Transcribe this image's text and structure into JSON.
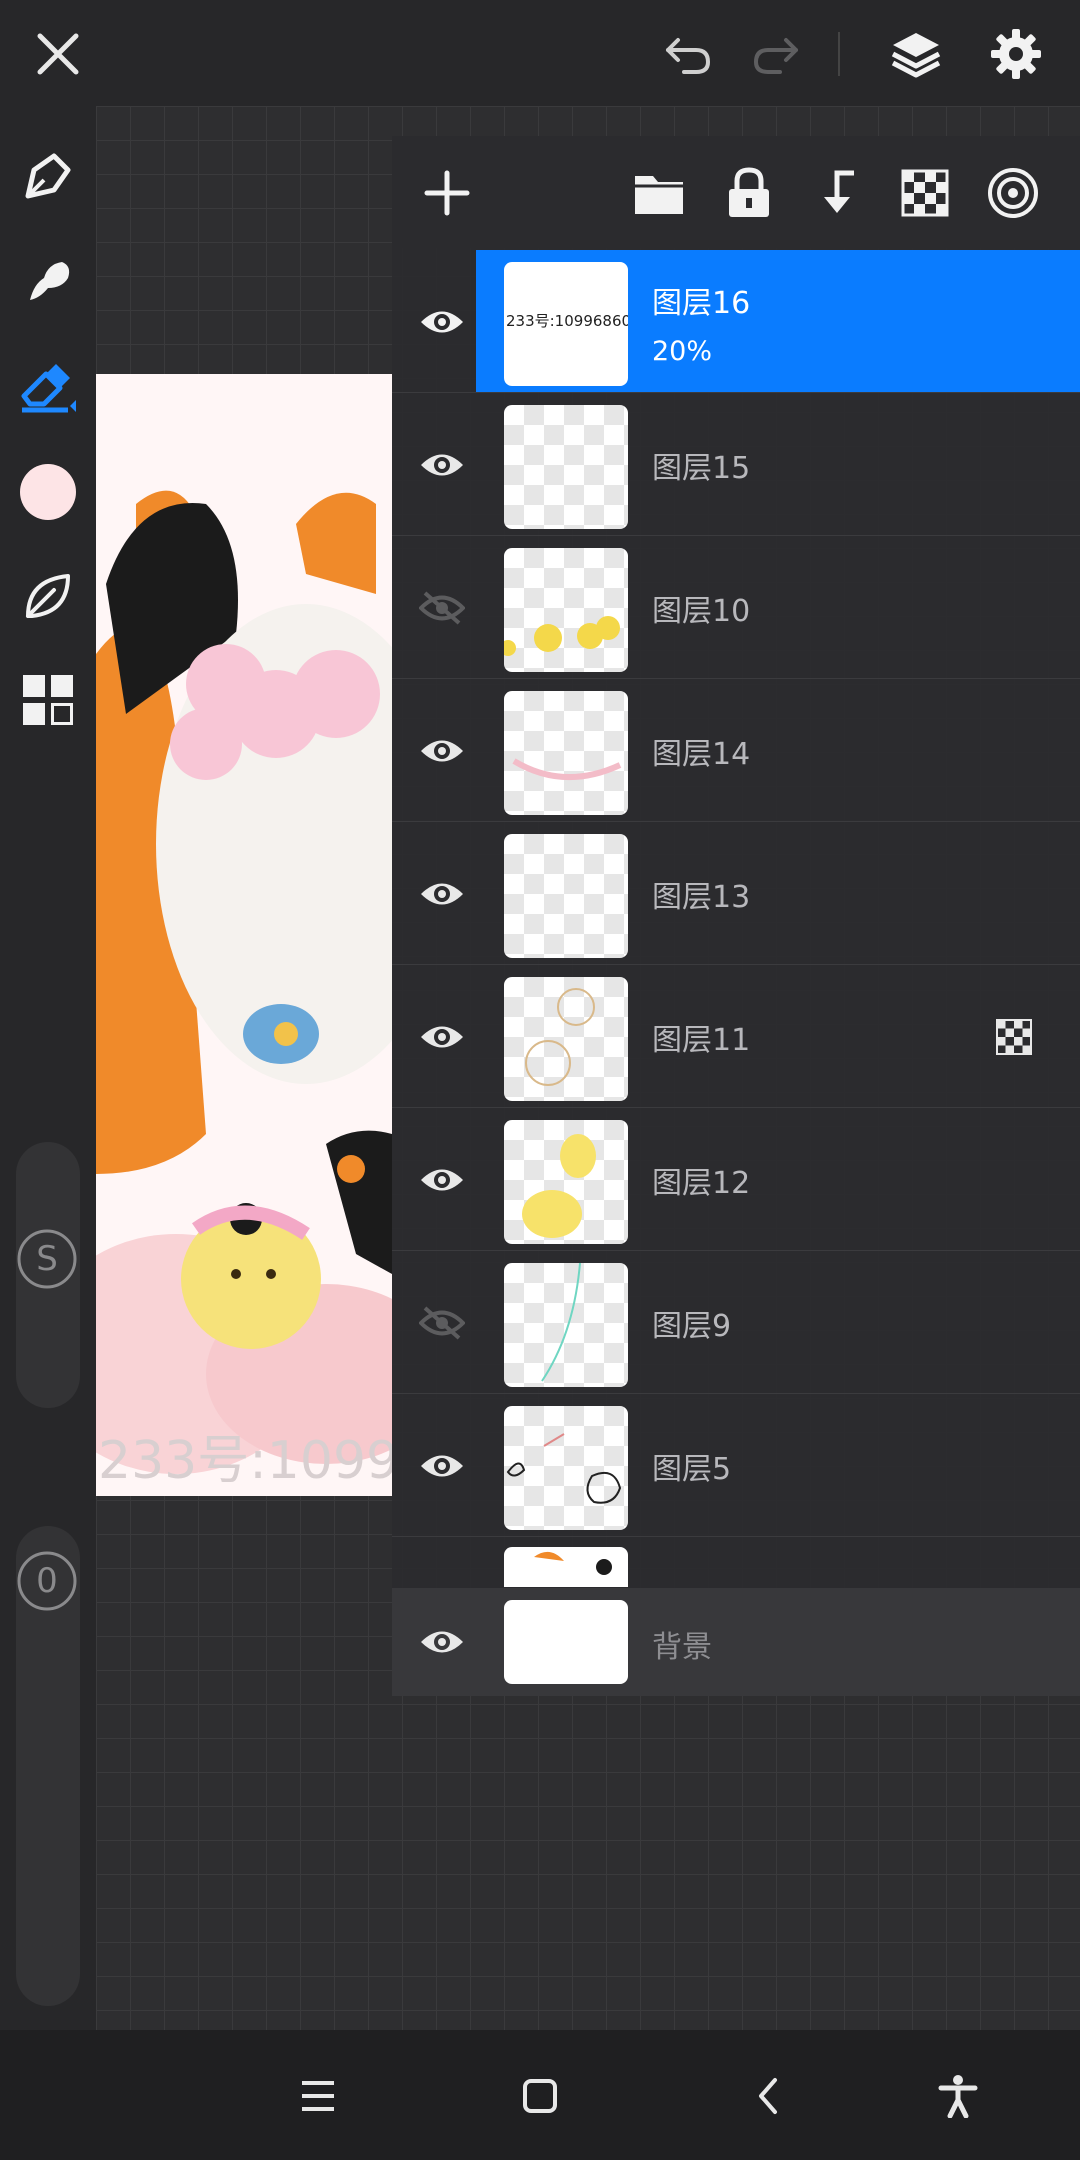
{
  "colors": {
    "accent": "#0a7cff",
    "brush_color": "#fde4e6"
  },
  "topbar": {
    "icons": [
      "close-icon",
      "undo-icon",
      "redo-icon",
      "layers-icon",
      "settings-icon"
    ]
  },
  "toolbar": {
    "tools": [
      "pen-icon",
      "smudge-icon",
      "eraser-icon",
      "color-swatch",
      "leaf-icon",
      "grid-icon"
    ],
    "size_label": "S",
    "opacity_label": "0"
  },
  "artwork": {
    "watermark": "233号:1099"
  },
  "layers_panel": {
    "tools": [
      "add-icon",
      "folder-icon",
      "lock-icon",
      "merge-down-icon",
      "alpha-lock-icon",
      "target-icon"
    ],
    "layers": [
      {
        "name": "图层16",
        "opacity": "20%",
        "visible": true,
        "selected": true,
        "thumb_text": "233号:10996860"
      },
      {
        "name": "图层15",
        "visible": true
      },
      {
        "name": "图层10",
        "visible": false
      },
      {
        "name": "图层14",
        "visible": true
      },
      {
        "name": "图层13",
        "visible": true
      },
      {
        "name": "图层11",
        "visible": true,
        "clipping": true
      },
      {
        "name": "图层12",
        "visible": true
      },
      {
        "name": "图层9",
        "visible": false
      },
      {
        "name": "图层5",
        "visible": true
      }
    ],
    "background": {
      "name": "背景",
      "visible": true
    }
  },
  "navbar": {
    "icons": [
      "menu-icon",
      "home-icon",
      "back-icon",
      "accessibility-icon"
    ]
  }
}
